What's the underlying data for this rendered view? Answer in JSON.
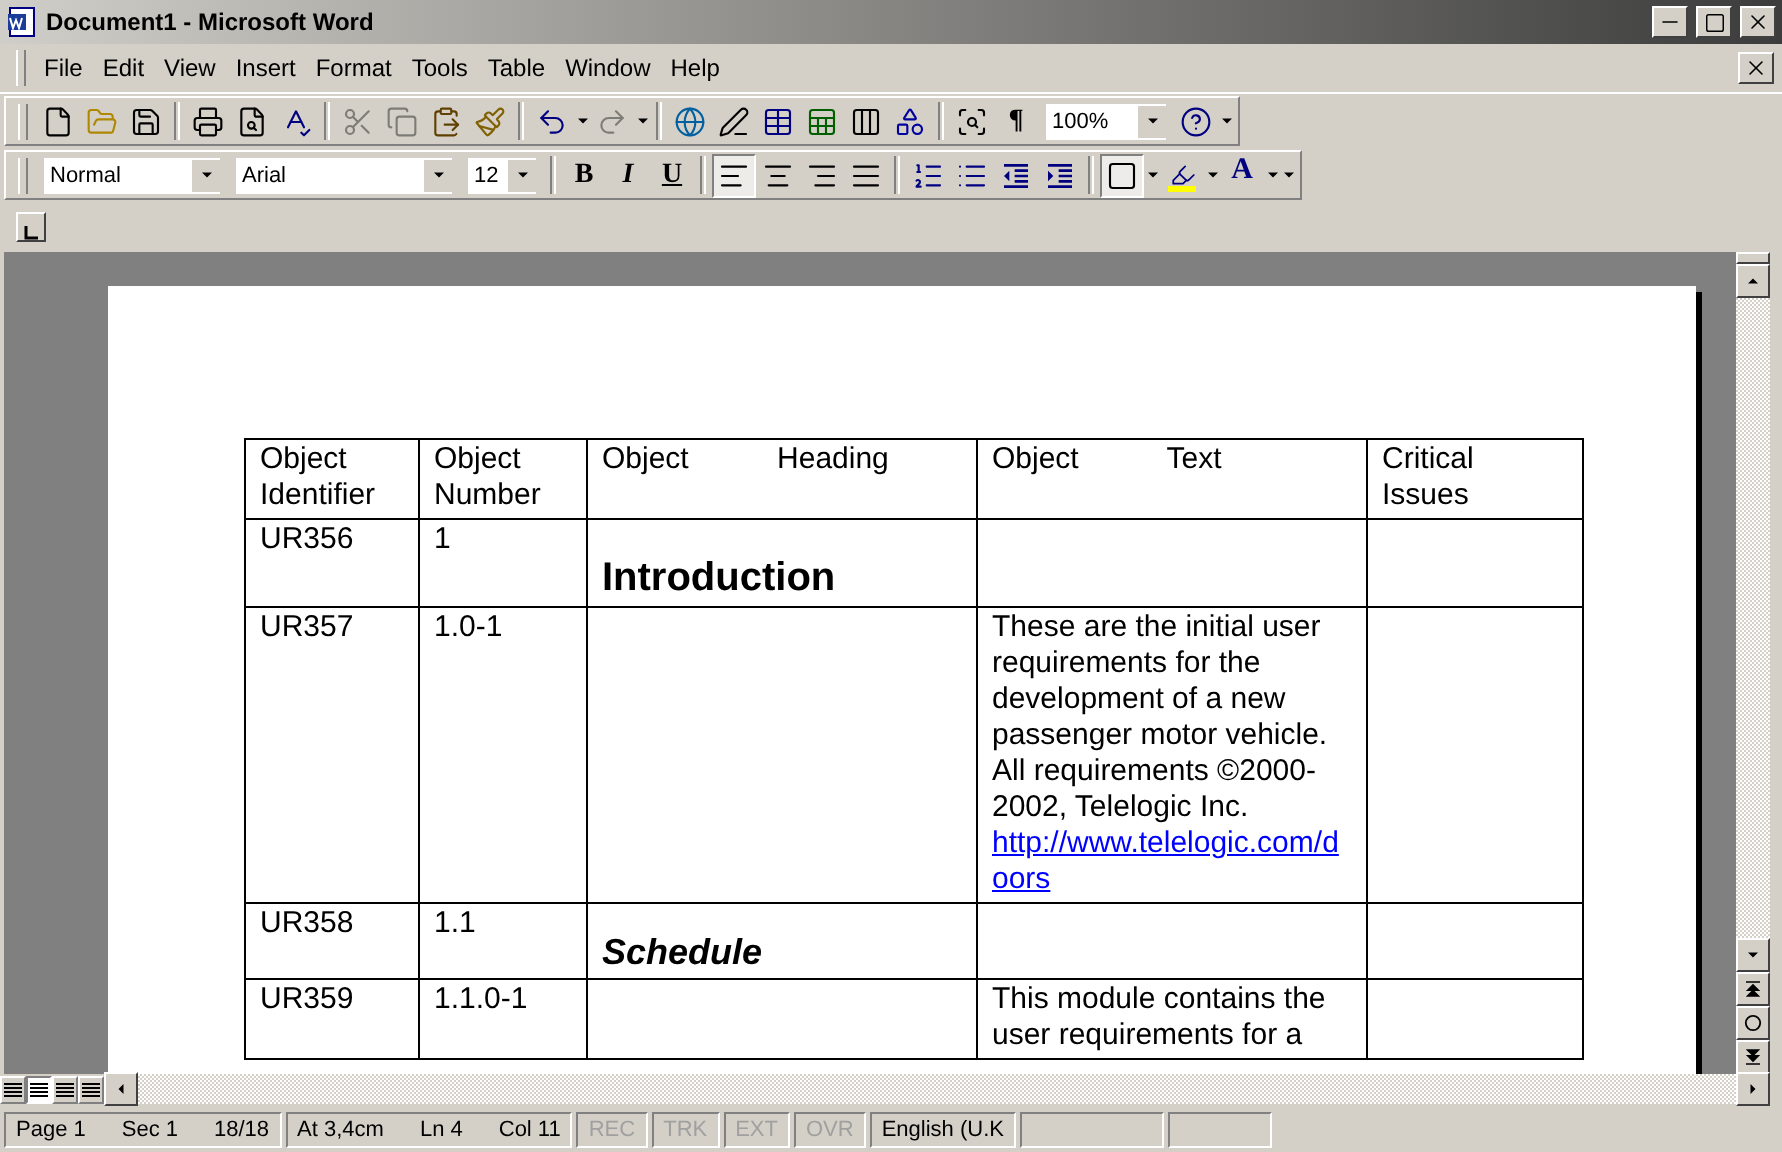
{
  "window": {
    "title": "Document1 - Microsoft Word"
  },
  "menu": [
    "File",
    "Edit",
    "View",
    "Insert",
    "Format",
    "Tools",
    "Table",
    "Window",
    "Help"
  ],
  "standard_toolbar": {
    "cut_disabled": true,
    "copy_disabled": true,
    "redo_disabled": true,
    "show_marks_symbol": "¶",
    "zoom": "100%"
  },
  "formatting_toolbar": {
    "style": "Normal",
    "font": "Arial",
    "size": "12",
    "bold_label": "B",
    "italic_label": "I",
    "underline_label": "U",
    "alignment": [
      {
        "selected": true
      },
      {
        "selected": false
      },
      {
        "selected": false
      },
      {
        "selected": false
      }
    ],
    "font_color_label": "A"
  },
  "table": {
    "columns": [
      "Object Identifier",
      "Object Number",
      "Object Heading",
      "Object Text",
      "Critical Issues"
    ],
    "rows": [
      {
        "identifier": "UR356",
        "number": "1",
        "heading": "Introduction",
        "kind": "heading1"
      },
      {
        "identifier": "UR357",
        "number": "1.0-1",
        "text": "These are the initial user requirements for the development of a new passenger motor vehicle. All requirements ©2000-2002, Telelogic Inc.",
        "link": "http://www.telelogic.com/doors"
      },
      {
        "identifier": "UR358",
        "number": "1.1",
        "heading": "Schedule",
        "kind": "heading2"
      },
      {
        "identifier": "UR359",
        "number": "1.1.0-1",
        "text": "This module contains the user requirements for a"
      }
    ]
  },
  "view_buttons": [
    {
      "selected": false
    },
    {
      "selected": true
    },
    {
      "selected": false
    },
    {
      "selected": false
    }
  ],
  "status_bar": {
    "fields": [
      {
        "text": "Page 1",
        "disabled": false
      },
      {
        "text": "Sec 1",
        "disabled": false
      },
      {
        "text": "18/18",
        "disabled": false
      },
      {
        "text": "At 3,4cm",
        "disabled": false
      },
      {
        "text": "Ln 4",
        "disabled": false
      },
      {
        "text": "Col 11",
        "disabled": false
      },
      {
        "text": "REC",
        "disabled": true
      },
      {
        "text": "TRK",
        "disabled": true
      },
      {
        "text": "EXT",
        "disabled": true
      },
      {
        "text": "OVR",
        "disabled": true
      },
      {
        "text": "English (U.K",
        "disabled": false
      }
    ]
  }
}
